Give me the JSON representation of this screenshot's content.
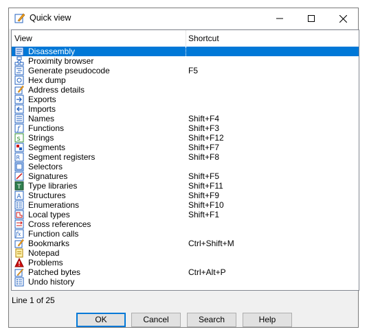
{
  "window": {
    "title": "Quick view"
  },
  "columns": {
    "view": "View",
    "shortcut": "Shortcut"
  },
  "items": [
    {
      "name": "Disassembly",
      "shortcut": "",
      "icon": "disassembly-icon"
    },
    {
      "name": "Proximity browser",
      "shortcut": "",
      "icon": "proximity-icon"
    },
    {
      "name": "Generate pseudocode",
      "shortcut": "F5",
      "icon": "pseudocode-icon"
    },
    {
      "name": "Hex dump",
      "shortcut": "",
      "icon": "hex-icon"
    },
    {
      "name": "Address details",
      "shortcut": "",
      "icon": "address-icon"
    },
    {
      "name": "Exports",
      "shortcut": "",
      "icon": "exports-icon"
    },
    {
      "name": "Imports",
      "shortcut": "",
      "icon": "imports-icon"
    },
    {
      "name": "Names",
      "shortcut": "Shift+F4",
      "icon": "names-icon"
    },
    {
      "name": "Functions",
      "shortcut": "Shift+F3",
      "icon": "functions-icon"
    },
    {
      "name": "Strings",
      "shortcut": "Shift+F12",
      "icon": "strings-icon"
    },
    {
      "name": "Segments",
      "shortcut": "Shift+F7",
      "icon": "segments-icon"
    },
    {
      "name": "Segment registers",
      "shortcut": "Shift+F8",
      "icon": "segment-registers-icon"
    },
    {
      "name": "Selectors",
      "shortcut": "",
      "icon": "selectors-icon"
    },
    {
      "name": "Signatures",
      "shortcut": "Shift+F5",
      "icon": "signatures-icon"
    },
    {
      "name": "Type libraries",
      "shortcut": "Shift+F11",
      "icon": "type-libraries-icon"
    },
    {
      "name": "Structures",
      "shortcut": "Shift+F9",
      "icon": "structures-icon"
    },
    {
      "name": "Enumerations",
      "shortcut": "Shift+F10",
      "icon": "enumerations-icon"
    },
    {
      "name": "Local types",
      "shortcut": "Shift+F1",
      "icon": "local-types-icon"
    },
    {
      "name": "Cross references",
      "shortcut": "",
      "icon": "xrefs-icon"
    },
    {
      "name": "Function calls",
      "shortcut": "",
      "icon": "function-calls-icon"
    },
    {
      "name": "Bookmarks",
      "shortcut": "Ctrl+Shift+M",
      "icon": "bookmarks-icon"
    },
    {
      "name": "Notepad",
      "shortcut": "",
      "icon": "notepad-icon"
    },
    {
      "name": "Problems",
      "shortcut": "",
      "icon": "problems-icon"
    },
    {
      "name": "Patched bytes",
      "shortcut": "Ctrl+Alt+P",
      "icon": "patched-bytes-icon"
    },
    {
      "name": "Undo history",
      "shortcut": "",
      "icon": "undo-history-icon"
    }
  ],
  "selected_index": 0,
  "status": "Line 1 of 25",
  "buttons": {
    "ok": "OK",
    "cancel": "Cancel",
    "search": "Search",
    "help": "Help"
  },
  "colors": {
    "selection": "#0078d7",
    "icon_blue": "#1f5fbf",
    "icon_red": "#d01010"
  }
}
